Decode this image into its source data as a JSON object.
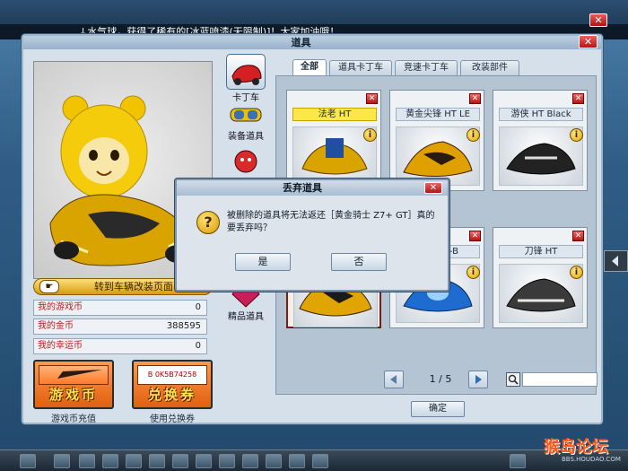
{
  "ticker": "↓水气球，获得了稀有的[冰蓝喷漆(无限制)]！大家加油哦！",
  "window": {
    "title": "道具",
    "close_glyph": "✕"
  },
  "preview": {
    "goto_label": "转到车辆改装页面",
    "hand_glyph": "☛"
  },
  "stats": [
    {
      "label": "我的游戏币",
      "value": "0"
    },
    {
      "label": "我的金币",
      "value": "388595"
    },
    {
      "label": "我的幸运币",
      "value": "0"
    }
  ],
  "buttons": {
    "game_coin": {
      "text": "游戏币",
      "caption": "游戏币充值"
    },
    "coupon": {
      "text": "兑换券",
      "caption": "使用兑换券",
      "code": "B 0K5B74258"
    }
  },
  "categories": [
    {
      "label": "卡丁车",
      "icon": "kart-icon"
    },
    {
      "label": "装备道具",
      "icon": "goggles-icon"
    },
    {
      "label": "角色/宠物",
      "icon": "character-icon"
    },
    {
      "label": "精品道具",
      "icon": "gem-icon"
    }
  ],
  "tabs": [
    "全部",
    "道具卡丁车",
    "竞速卡丁车",
    "改装部件"
  ],
  "items": [
    {
      "name": "法老 HT",
      "selected": false
    },
    {
      "name": "黄金尖锋 HT LE",
      "selected": false
    },
    {
      "name": "游侠 HT Black",
      "selected": false
    },
    {
      "name": "黄金骑士 Z7+ GT",
      "selected": true
    },
    {
      "name": "蓝影 HT-B",
      "selected": false
    },
    {
      "name": "刀锋 HT",
      "selected": false
    }
  ],
  "card_close_glyph": "✕",
  "info_glyph": "i",
  "pager": {
    "text": "1 / 5"
  },
  "ok_label": "确定",
  "dialog": {
    "title": "丢弃道具",
    "close_glyph": "✕",
    "q_glyph": "?",
    "message": "被删除的道具将无法返还［黄金骑士 Z7+ GT］真的要丢弃吗？",
    "yes": "是",
    "no": "否"
  },
  "watermark": {
    "brand": "猴岛论坛",
    "url": "BBS.HOUDAO.COM"
  },
  "top_close_glyph": "✕",
  "colors": {
    "accent_orange": "#e06010",
    "close_red": "#b21414",
    "selected_name": "#ffe74a"
  }
}
